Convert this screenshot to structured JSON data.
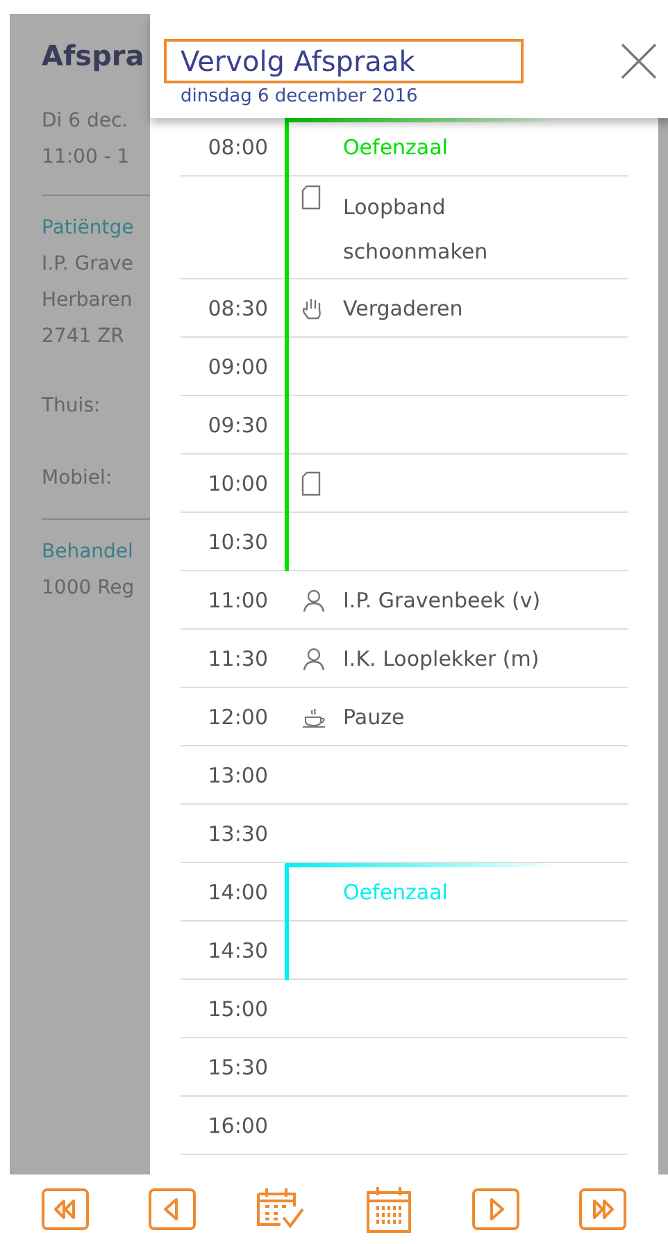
{
  "background_page": {
    "title": "Afspra",
    "lines": [
      {
        "kind": "text",
        "text": "Di 6 dec."
      },
      {
        "kind": "text",
        "text": "11:00 - 1"
      },
      {
        "kind": "divider"
      },
      {
        "kind": "heading",
        "text": "Patiëntge"
      },
      {
        "kind": "text",
        "text": "I.P. Grave"
      },
      {
        "kind": "text",
        "text": "Herbaren"
      },
      {
        "kind": "text",
        "text": "2741 ZR"
      },
      {
        "kind": "label",
        "text": "Thuis:"
      },
      {
        "kind": "label",
        "text": "Mobiel:"
      },
      {
        "kind": "divider"
      },
      {
        "kind": "heading",
        "text": "Behandel"
      },
      {
        "kind": "text",
        "text": "1000 Reg"
      }
    ]
  },
  "dialog": {
    "title": "Vervolg Afspraak",
    "date": "dinsdag 6 december 2016"
  },
  "rows": [
    {
      "time": "08:00",
      "color": "#00e000",
      "event": {
        "kind": "resource",
        "text": "Oefenzaal"
      }
    },
    {
      "time": "",
      "color": "#00e000",
      "event": {
        "kind": "task",
        "text": "Loopband schoonmaken"
      }
    },
    {
      "time": "08:30",
      "color": "#00e000",
      "event": {
        "kind": "meeting",
        "text": "Vergaderen"
      }
    },
    {
      "time": "09:00",
      "color": "#00e000"
    },
    {
      "time": "09:30",
      "color": "#00e000"
    },
    {
      "time": "10:00",
      "color": "#00e000",
      "event": {
        "kind": "task"
      }
    },
    {
      "time": "10:30",
      "color": "#00e000"
    },
    {
      "time": "11:00",
      "event": {
        "kind": "patient",
        "text": "I.P. Gravenbeek (v)"
      }
    },
    {
      "time": "11:30",
      "event": {
        "kind": "patient",
        "text": "I.K. Looplekker (m)"
      }
    },
    {
      "time": "12:00",
      "event": {
        "kind": "break",
        "text": "Pauze"
      }
    },
    {
      "time": "13:00"
    },
    {
      "time": "13:30"
    },
    {
      "time": "14:00",
      "color": "#00f0f0",
      "event": {
        "kind": "resource",
        "text": "Oefenzaal"
      }
    },
    {
      "time": "14:30",
      "color": "#00f0f0"
    },
    {
      "time": "15:00"
    },
    {
      "time": "15:30"
    },
    {
      "time": "16:00"
    }
  ],
  "toolbar": [
    {
      "kind": "first"
    },
    {
      "kind": "prev"
    },
    {
      "kind": "pick"
    },
    {
      "kind": "calendar"
    },
    {
      "kind": "next"
    },
    {
      "kind": "last"
    }
  ]
}
